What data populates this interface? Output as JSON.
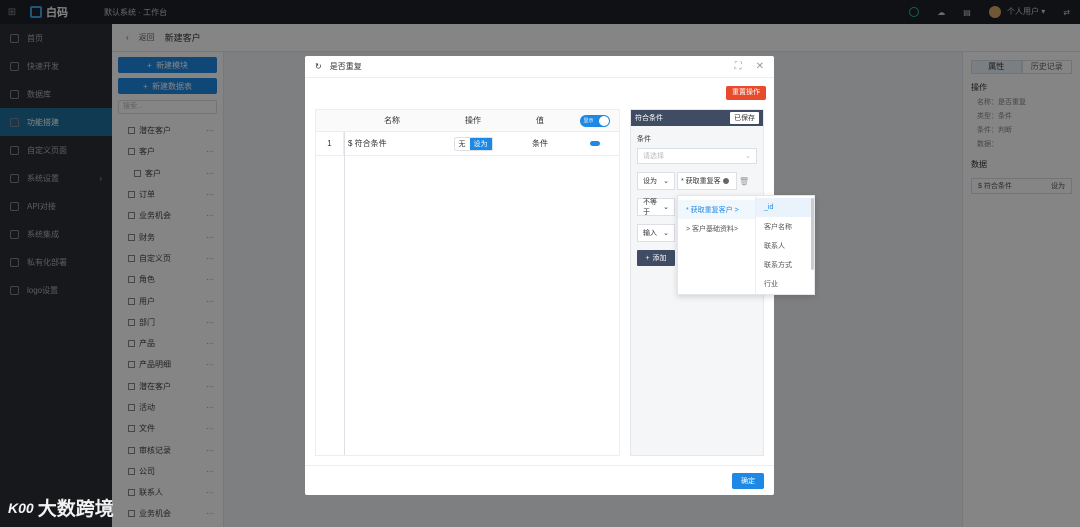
{
  "topbar": {
    "logo_text": "白码",
    "breadcrumb": "默认系统 · 工作台",
    "user": "个人用户",
    "user_caret": "▾",
    "switch_icon": "⇄"
  },
  "nav": {
    "items": [
      {
        "label": "首页"
      },
      {
        "label": "快速开发"
      },
      {
        "label": "数据库"
      },
      {
        "label": "功能搭建",
        "active": true
      },
      {
        "label": "自定义页面"
      },
      {
        "label": "系统设置",
        "has_chevron": true
      },
      {
        "label": "API对接"
      },
      {
        "label": "系统集成"
      },
      {
        "label": "私有化部署"
      },
      {
        "label": "logo设置"
      }
    ]
  },
  "subbar": {
    "back": "返回",
    "back_icon": "‹",
    "page": "新建客户"
  },
  "tree": {
    "new_module": "新建模块",
    "new_table": "新建数据表",
    "search_placeholder": "搜索...",
    "items": [
      {
        "label": "潜在客户",
        "level": 0
      },
      {
        "label": "客户",
        "level": 0
      },
      {
        "label": "客户",
        "level": 1
      },
      {
        "label": "订单",
        "level": 0
      },
      {
        "label": "业务机会",
        "level": 0
      },
      {
        "label": "财务",
        "level": 0
      },
      {
        "label": "自定义页",
        "level": 0
      },
      {
        "label": "角色",
        "level": 0
      },
      {
        "label": "用户",
        "level": 0
      },
      {
        "label": "部门",
        "level": 0
      },
      {
        "label": "产品",
        "level": 0
      },
      {
        "label": "产品明细",
        "level": 0
      },
      {
        "label": "潜在客户",
        "level": 0
      },
      {
        "label": "活动",
        "level": 0
      },
      {
        "label": "文件",
        "level": 0
      },
      {
        "label": "审核记录",
        "level": 0
      },
      {
        "label": "公司",
        "level": 0
      },
      {
        "label": "联系人",
        "level": 0
      },
      {
        "label": "业务机会",
        "level": 0
      }
    ]
  },
  "props": {
    "tab_attr": "属性",
    "tab_history": "历史记录",
    "op_heading": "操作",
    "op_lines": [
      "名称：是否重复",
      "类型：条件",
      "条件：判断",
      "数据："
    ],
    "data_heading": "数据",
    "data_row_name": "$ 符合条件",
    "data_row_val": "设为"
  },
  "modal": {
    "title": "是否重复",
    "refresh_icon": "↻",
    "expand_icon": "⛶",
    "close_icon": "✕",
    "reset_btn": "重置操作",
    "table": {
      "headers": {
        "name": "名称",
        "op": "操作",
        "val": "值",
        "switch": "显示"
      },
      "row": {
        "idx": "1",
        "name": "$ 符合条件",
        "seg_none": "无",
        "seg_set": "设为",
        "val": "条件"
      }
    },
    "cond": {
      "title": "符合条件",
      "saved": "已保存",
      "label": "条件",
      "select_placeholder": "请选择",
      "caret": "⌄",
      "row1_op": "设为",
      "row1_tag": "* 获取重复客",
      "row2_op": "不等于",
      "row3_op": "输入",
      "trash_icon": "🗑",
      "add_btn": "添加",
      "add_icon": "+"
    },
    "ok_btn": "确定"
  },
  "dropdown": {
    "col1": [
      {
        "label": "* 获取重复客户 >",
        "active": true
      },
      {
        "label": "> 客户基础资料>",
        "active": false
      }
    ],
    "col2": [
      "_id",
      "客户名称",
      "联系人",
      "联系方式",
      "行业"
    ]
  },
  "watermark": {
    "logo": "K00",
    "text": "大数跨境"
  }
}
